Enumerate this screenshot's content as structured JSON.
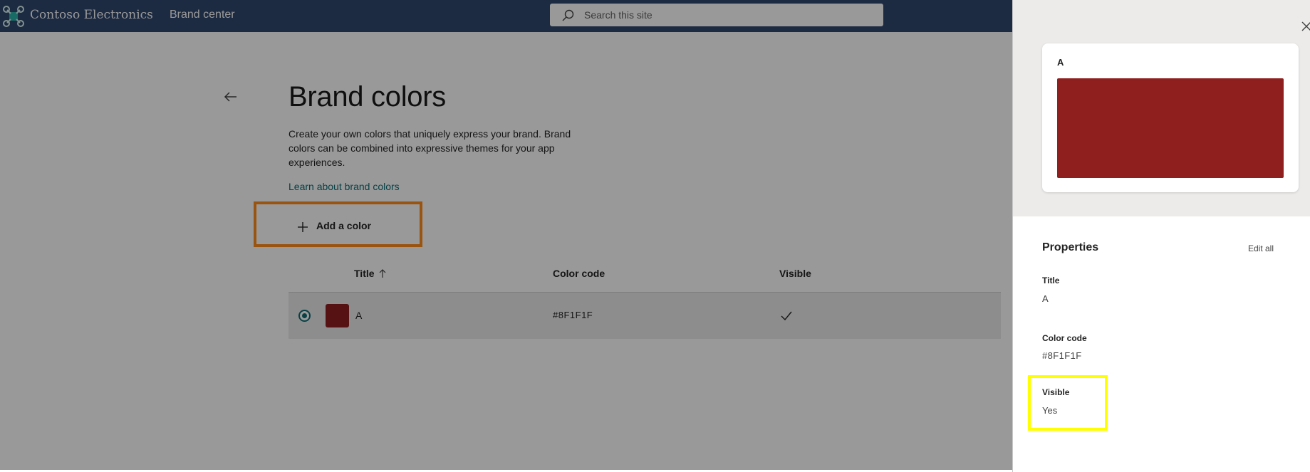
{
  "header": {
    "site_name": "Contoso Electronics",
    "nav_item": "Brand center",
    "search_placeholder": "Search this site"
  },
  "page": {
    "title": "Brand colors",
    "description": "Create your own colors that uniquely express your brand. Brand colors can be combined into expressive themes for your app experiences.",
    "learn_link": "Learn about brand colors",
    "add_button_label": "Add a color"
  },
  "table": {
    "columns": {
      "title": "Title",
      "color_code": "Color code",
      "visible": "Visible"
    },
    "sort_indicator": "ascending",
    "rows": [
      {
        "title": "A",
        "color_code": "#8F1F1F",
        "visible": true,
        "selected": true,
        "swatch_color": "#8F1F1F"
      }
    ]
  },
  "panel": {
    "preview_label": "A",
    "preview_color": "#8F1F1F",
    "properties_heading": "Properties",
    "edit_all_label": "Edit all",
    "fields": {
      "title_label": "Title",
      "title_value": "A",
      "code_label": "Color code",
      "code_value": "#8F1F1F",
      "visible_label": "Visible",
      "visible_value": "Yes"
    }
  },
  "colors": {
    "topbar": "#2f476e",
    "accent": "#0f6b73",
    "add_highlight": "#ff8c1a",
    "visible_highlight": "#ffff00"
  },
  "icons": {
    "logo": "drone-logo-icon",
    "search": "search-icon",
    "back": "arrow-left-icon",
    "add": "plus-icon",
    "sort": "arrow-up-icon",
    "check": "checkmark-icon",
    "close": "close-icon"
  }
}
